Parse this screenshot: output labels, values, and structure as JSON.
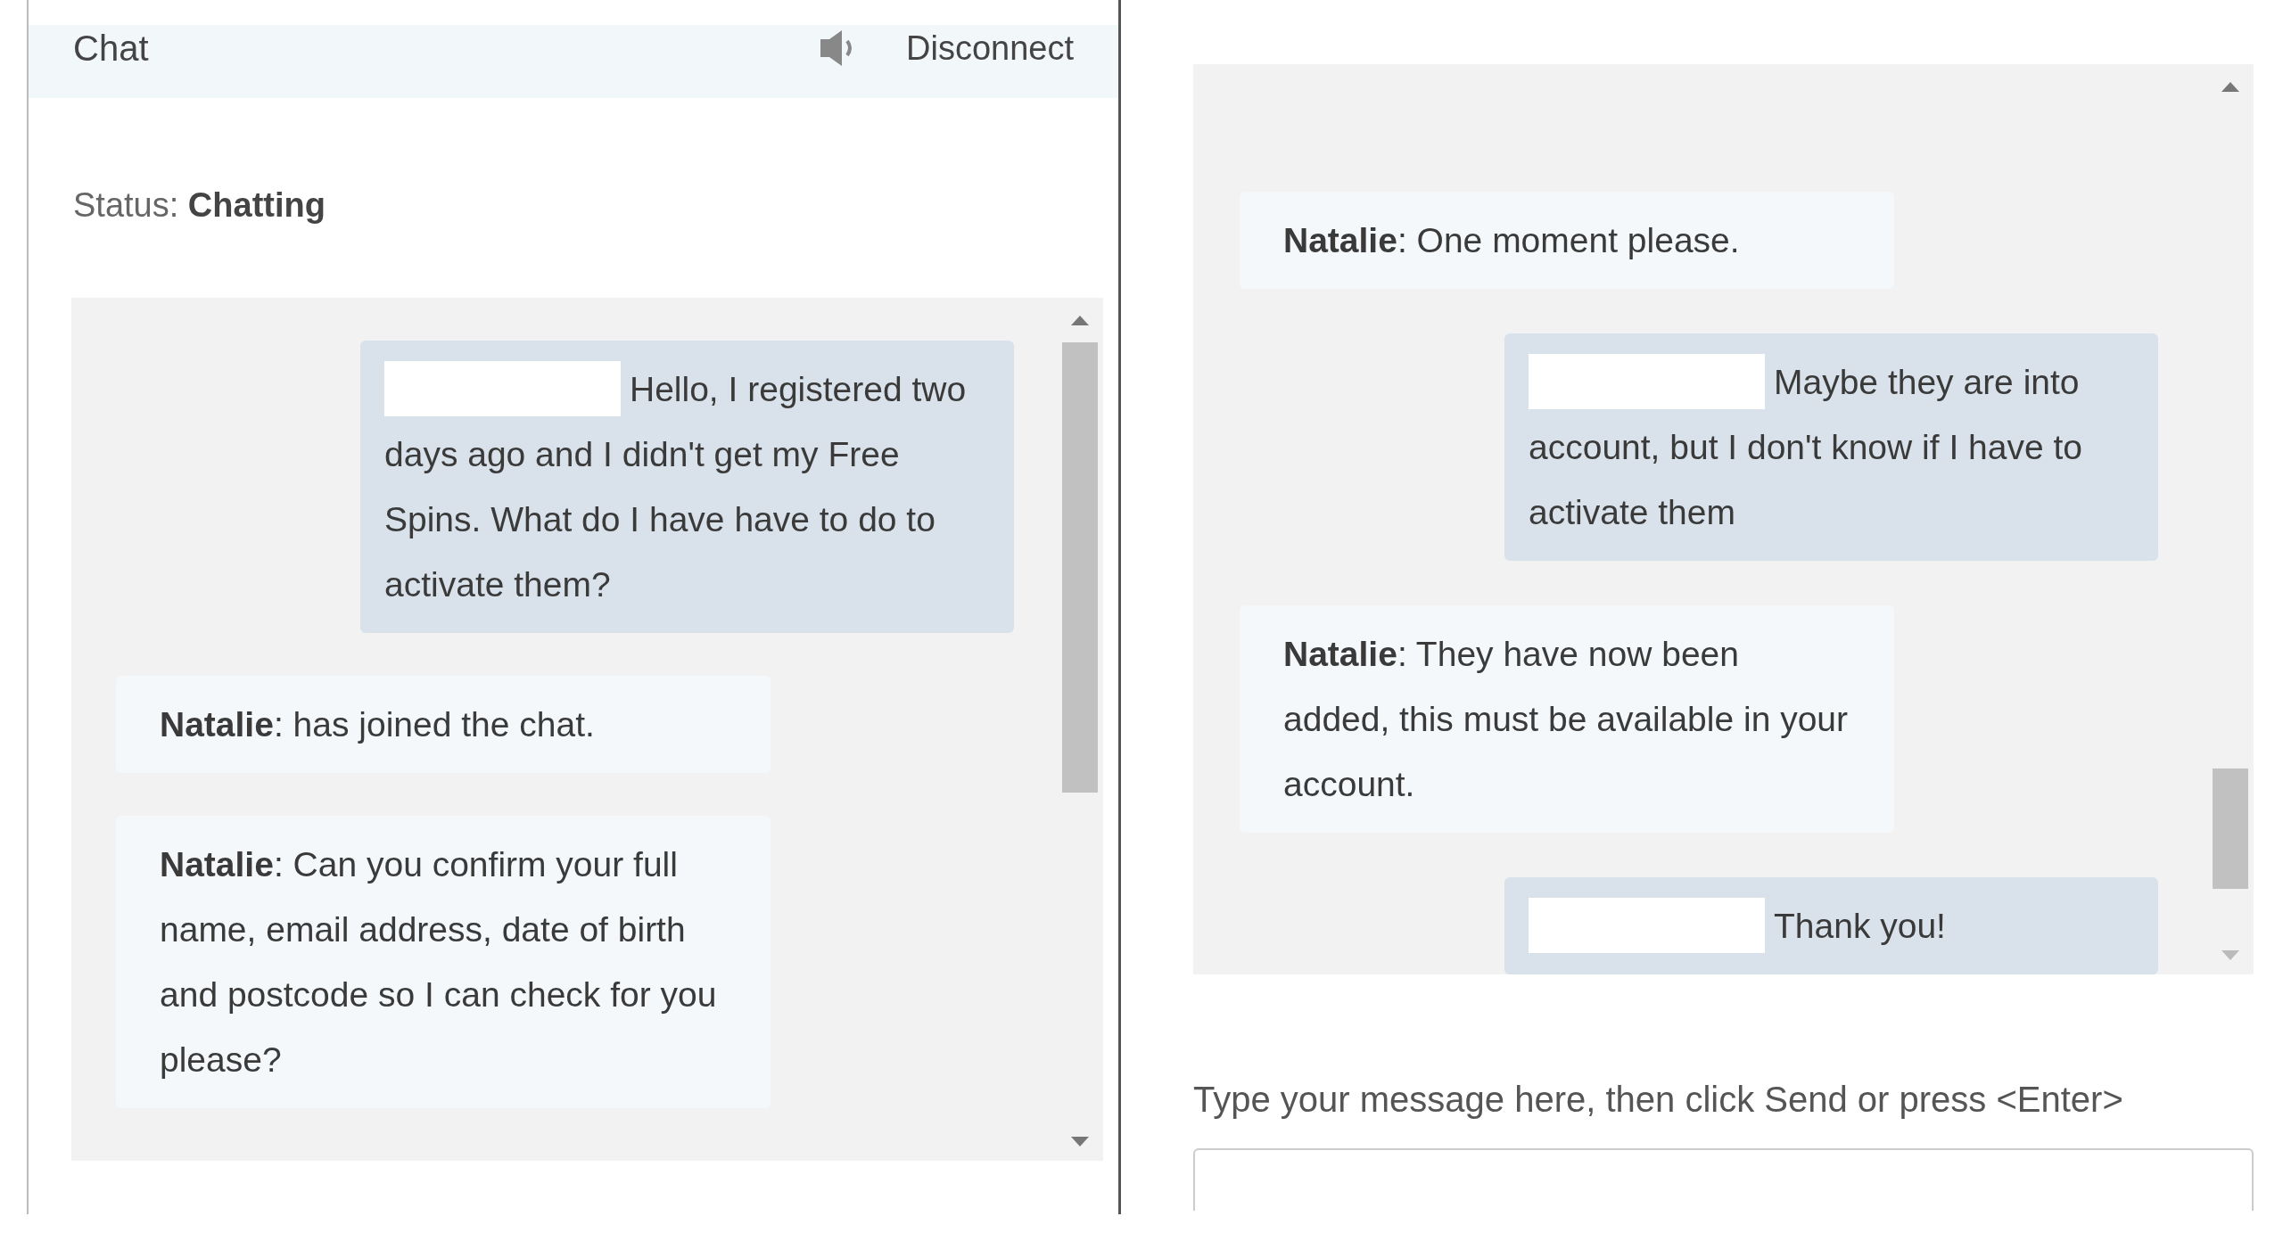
{
  "left_panel": {
    "header": {
      "title": "Chat",
      "disconnect": "Disconnect"
    },
    "status": {
      "label": "Status:",
      "value": "Chatting"
    },
    "messages": [
      {
        "kind": "user",
        "redacted": true,
        "text": "Hello, I registered two days ago and I didn't get my Free Spins. What do I have have to do to activate them?"
      },
      {
        "kind": "agent",
        "redacted": false,
        "text": "**Natalie**: has joined the chat."
      },
      {
        "kind": "agent",
        "redacted": false,
        "text": "**Natalie**: Can you confirm your full name, email address, date of birth and postcode so I can check for you please?"
      }
    ]
  },
  "right_panel": {
    "messages": [
      {
        "kind": "agent",
        "redacted": false,
        "text": "**Natalie**: One moment please."
      },
      {
        "kind": "user",
        "redacted": true,
        "text": "Maybe they are into account, but I don't know if I have to activate them"
      },
      {
        "kind": "agent",
        "redacted": false,
        "text": "**Natalie**: They have now been added, this must be available in your account."
      },
      {
        "kind": "user",
        "redacted": true,
        "text": "Thank you!"
      }
    ],
    "composer": {
      "label": "Type your message here, then click Send or press <Enter>"
    }
  }
}
